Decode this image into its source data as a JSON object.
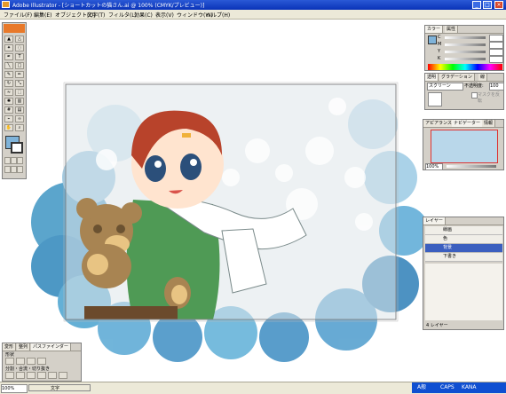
{
  "window": {
    "title": "Adobe Illustrator - [ショートカットの猫さん.ai @ 100% (CMYK/プレビュー)]",
    "minimize": "_",
    "maximize": "□",
    "close": "×"
  },
  "menu": [
    "ファイル(F)",
    "編集(E)",
    "オブジェクト(O)",
    "文字(T)",
    "フィルタ(L)",
    "効果(C)",
    "表示(V)",
    "ウィンドウ(W)",
    "ヘルプ(H)"
  ],
  "color_panel": {
    "tabs": [
      "カラー",
      "属性"
    ],
    "channels": [
      "C",
      "M",
      "Y",
      "K"
    ]
  },
  "transparency_panel": {
    "tabs": [
      "透明",
      "グラデーション",
      "線"
    ],
    "mode": "スクリーン",
    "opacity_label": "不透明度:",
    "opacity": "100",
    "option_label": "マスクを反転"
  },
  "navigator_panel": {
    "tabs": [
      "アピアランス",
      "ナビゲーター",
      "情報"
    ],
    "zoom": "100%"
  },
  "layers_panel": {
    "tabs": [
      "レイヤー"
    ],
    "layers": [
      "線画",
      "色",
      "背景",
      "下書き"
    ],
    "selected_index": 2,
    "footer": "4 レイヤー"
  },
  "pathfinder_panel": {
    "tabs": [
      "変形",
      "整列",
      "パスファインダー"
    ],
    "section1": "形状",
    "section2": "分割・合流・切り抜き"
  },
  "status": {
    "zoom": "100%",
    "tool": "文字"
  },
  "tray": {
    "lang": "A般",
    "caps": "CAPS",
    "kana": "KANA"
  },
  "colors": {
    "title_blue": "#0a33b8",
    "layer_selected": "#3b5fbf",
    "panel_gray": "#d4d0c8"
  }
}
